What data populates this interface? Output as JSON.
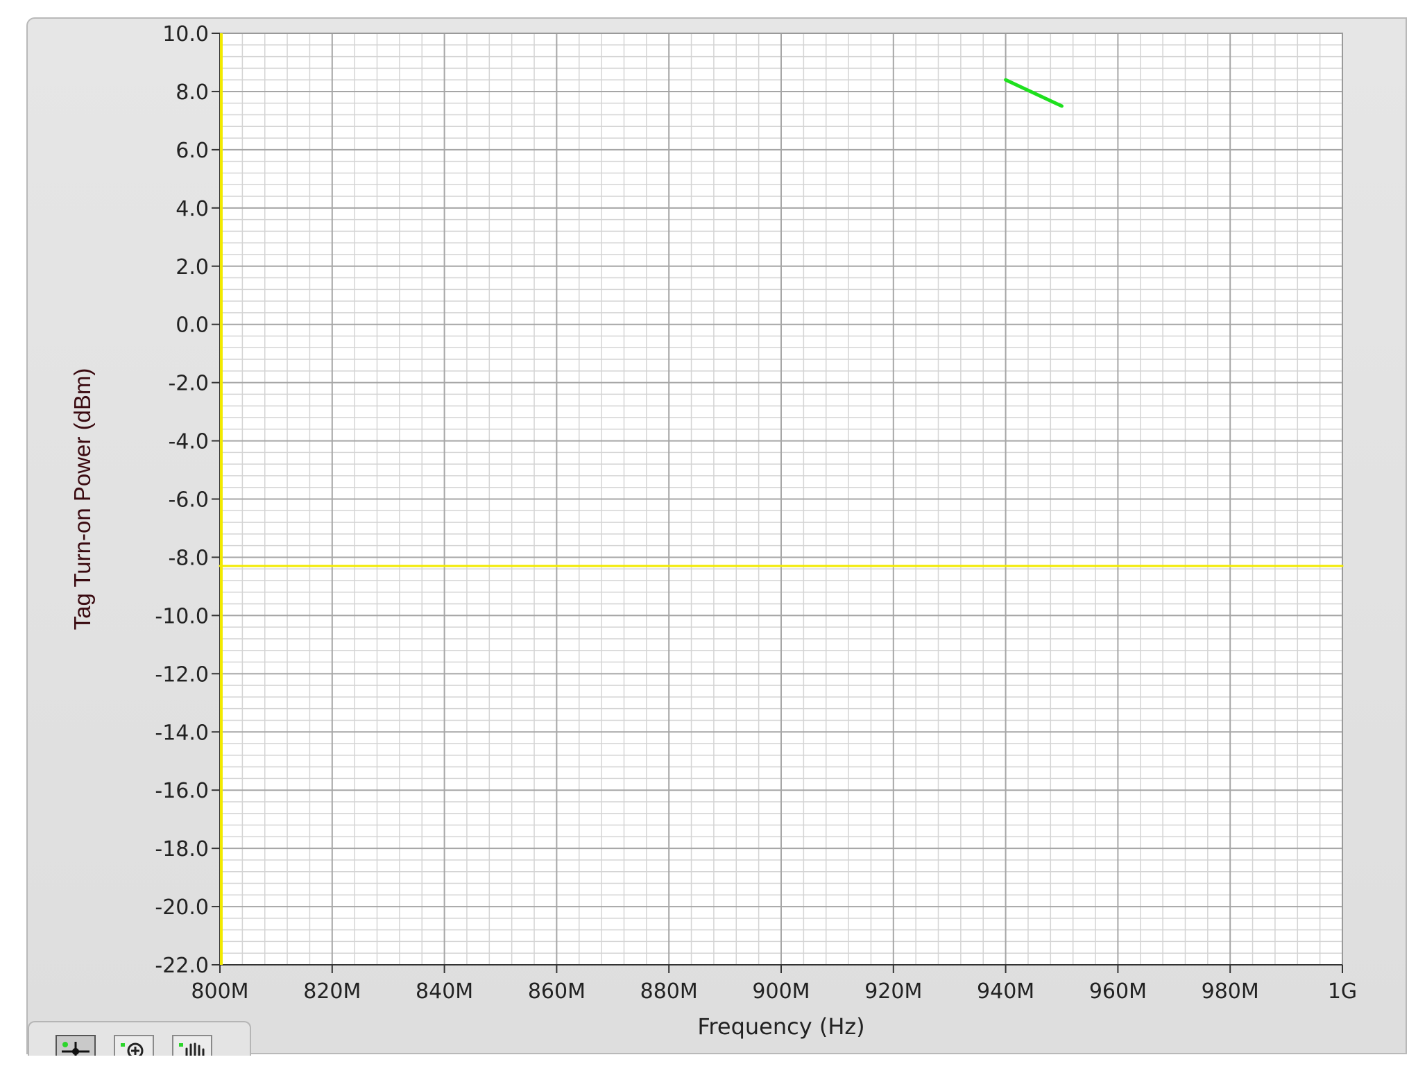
{
  "chart_data": {
    "type": "line",
    "title": "",
    "xlabel": "Frequency (Hz)",
    "ylabel": "Tag Turn-on Power (dBm)",
    "xlim": [
      800000000,
      1000000000
    ],
    "ylim": [
      -22,
      10
    ],
    "x_ticks": [
      {
        "value": 800000000,
        "label": "800M"
      },
      {
        "value": 820000000,
        "label": "820M"
      },
      {
        "value": 840000000,
        "label": "840M"
      },
      {
        "value": 860000000,
        "label": "860M"
      },
      {
        "value": 880000000,
        "label": "880M"
      },
      {
        "value": 900000000,
        "label": "900M"
      },
      {
        "value": 920000000,
        "label": "920M"
      },
      {
        "value": 940000000,
        "label": "940M"
      },
      {
        "value": 960000000,
        "label": "960M"
      },
      {
        "value": 980000000,
        "label": "980M"
      },
      {
        "value": 1000000000,
        "label": "1G"
      }
    ],
    "y_ticks": [
      {
        "value": 10,
        "label": "10.0"
      },
      {
        "value": 8,
        "label": "8.0"
      },
      {
        "value": 6,
        "label": "6.0"
      },
      {
        "value": 4,
        "label": "4.0"
      },
      {
        "value": 2,
        "label": "2.0"
      },
      {
        "value": 0,
        "label": "0.0"
      },
      {
        "value": -2,
        "label": "-2.0"
      },
      {
        "value": -4,
        "label": "-4.0"
      },
      {
        "value": -6,
        "label": "-6.0"
      },
      {
        "value": -8,
        "label": "-8.0"
      },
      {
        "value": -10,
        "label": "-10.0"
      },
      {
        "value": -12,
        "label": "-12.0"
      },
      {
        "value": -14,
        "label": "-14.0"
      },
      {
        "value": -16,
        "label": "-16.0"
      },
      {
        "value": -18,
        "label": "-18.0"
      },
      {
        "value": -20,
        "label": "-20.0"
      },
      {
        "value": -22,
        "label": "-22.0"
      }
    ],
    "grid": true,
    "minor_grid": true,
    "legend": false,
    "series": [
      {
        "color": "#f2ea00",
        "x": [
          800000000,
          1000000000
        ],
        "y": [
          -8.3,
          -8.3
        ]
      },
      {
        "color": "#1ee01e",
        "x": [
          940000000,
          950000000
        ],
        "y": [
          8.4,
          7.5
        ]
      }
    ],
    "cursor_line": {
      "color": "#f2ea00",
      "x": 800000000
    }
  },
  "colors": {
    "panel": "#e1e1e1",
    "plot_background": "#ffffff",
    "major_grid": "#a6a6a6",
    "minor_grid": "#d4d4d4"
  },
  "palette": {
    "tools": [
      {
        "icon": "cursor-crosshair-icon",
        "active": true
      },
      {
        "icon": "zoom-icon",
        "active": false
      },
      {
        "icon": "pan-hand-icon",
        "active": false
      }
    ]
  }
}
